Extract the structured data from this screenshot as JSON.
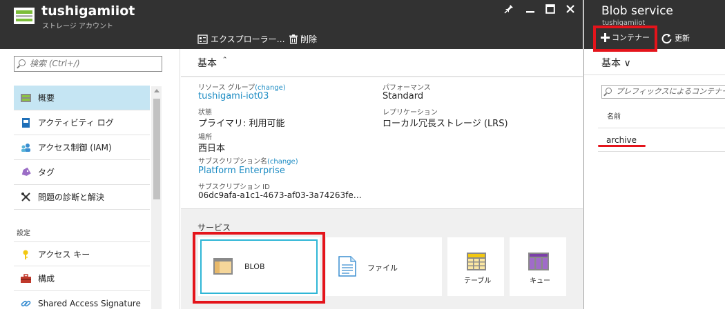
{
  "account": {
    "title": "tushigamiiot",
    "subtitle": "ストレージ アカウント",
    "window_buttons": [
      "📌",
      "—",
      "□",
      "✕"
    ],
    "toolbar": {
      "explorer_label": "エクスプローラー…",
      "delete_label": "削除"
    }
  },
  "sidebar": {
    "search_placeholder": "検索 (Ctrl+/)",
    "items": [
      {
        "label": "概要",
        "icon": "overview-icon",
        "active": true
      },
      {
        "label": "アクティビティ ログ",
        "icon": "activity-log-icon"
      },
      {
        "label": "アクセス制御 (IAM)",
        "icon": "iam-icon"
      },
      {
        "label": "タグ",
        "icon": "tag-icon"
      },
      {
        "label": "問題の診断と解決",
        "icon": "wrench-icon"
      }
    ],
    "settings_header": "設定",
    "settings_items": [
      {
        "label": "アクセス キー",
        "icon": "key-icon"
      },
      {
        "label": "構成",
        "icon": "toolbox-icon"
      },
      {
        "label": "Shared Access Signature",
        "icon": "link-icon"
      }
    ]
  },
  "essentials": {
    "label": "基本 ＾",
    "resource_group": {
      "label": "リソース グループ",
      "change": "(change)",
      "value": "tushigami-iot03"
    },
    "status": {
      "label": "状態",
      "value": "プライマリ: 利用可能"
    },
    "location": {
      "label": "場所",
      "value": "西日本"
    },
    "subscription_name": {
      "label": "サブスクリプション名",
      "change": "(change)",
      "value": "Platform Enterprise"
    },
    "subscription_id": {
      "label": "サブスクリプション ID",
      "value": "06dc9afa-a1c1-4673-af03-3a74263fe…"
    },
    "performance": {
      "label": "パフォーマンス",
      "value": "Standard"
    },
    "replication": {
      "label": "レプリケーション",
      "value": "ローカル冗長ストレージ (LRS)"
    }
  },
  "services": {
    "label": "サービス",
    "tiles": [
      {
        "label": "BLOB",
        "icon": "blob-icon"
      },
      {
        "label": "ファイル",
        "icon": "file-icon"
      },
      {
        "label": "テーブル",
        "icon": "table-icon"
      },
      {
        "label": "キュー",
        "icon": "queue-icon"
      }
    ]
  },
  "blob": {
    "title": "Blob service",
    "subtitle": "tushigamiiot",
    "add_container": "＋ コンテナー",
    "refresh": "更新",
    "essentials_label": "基本 ∨",
    "search_placeholder": "プレフィックスによるコンテナーの検索",
    "column_name": "名前",
    "containers": [
      "archive"
    ]
  },
  "colors": {
    "header": "#323232",
    "accent": "#1b8bc3",
    "active_nav": "#c5e5f3",
    "annotation": "#e4141b"
  }
}
